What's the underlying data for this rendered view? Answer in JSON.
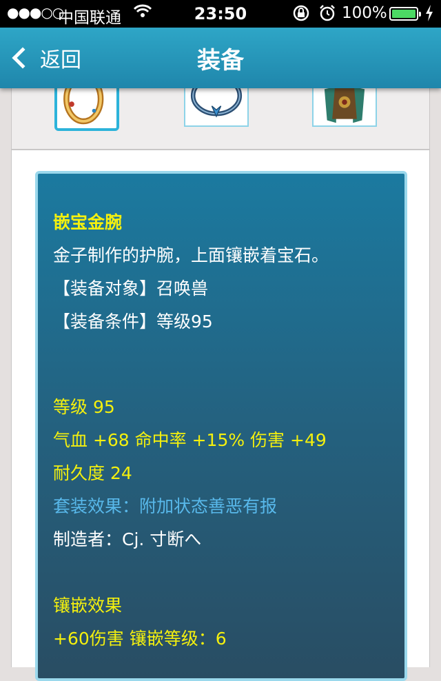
{
  "status_bar": {
    "signal": "●●●○○",
    "carrier": "中国联通",
    "time": "23:50",
    "battery": "100%",
    "battery_level": 1.0
  },
  "nav": {
    "back_label": "返回",
    "title": "装备"
  },
  "equipment_slots": [
    {
      "icon": "gold-bracelet-icon",
      "selected": true
    },
    {
      "icon": "gem-ring-icon",
      "selected": false
    },
    {
      "icon": "armor-icon",
      "selected": false
    }
  ],
  "item": {
    "name": "嵌宝金腕",
    "description": "金子制作的护腕，上面镶嵌着宝石。",
    "target": "【装备对象】召唤兽",
    "requirement": "【装备条件】等级95",
    "level": "等级 95",
    "stats": "气血 +68 命中率 +15% 伤害 +49",
    "durability": "耐久度 24",
    "set_effect": "套装效果：附加状态善恶有报",
    "maker": "制造者：Cj.  寸断へ",
    "inlay_title": "镶嵌效果",
    "inlay_detail": "+60伤害 镶嵌等级：6"
  },
  "colors": {
    "accent": "#2ea6c7",
    "highlight_text": "#f4f00e",
    "set_text": "#58b8ea"
  }
}
